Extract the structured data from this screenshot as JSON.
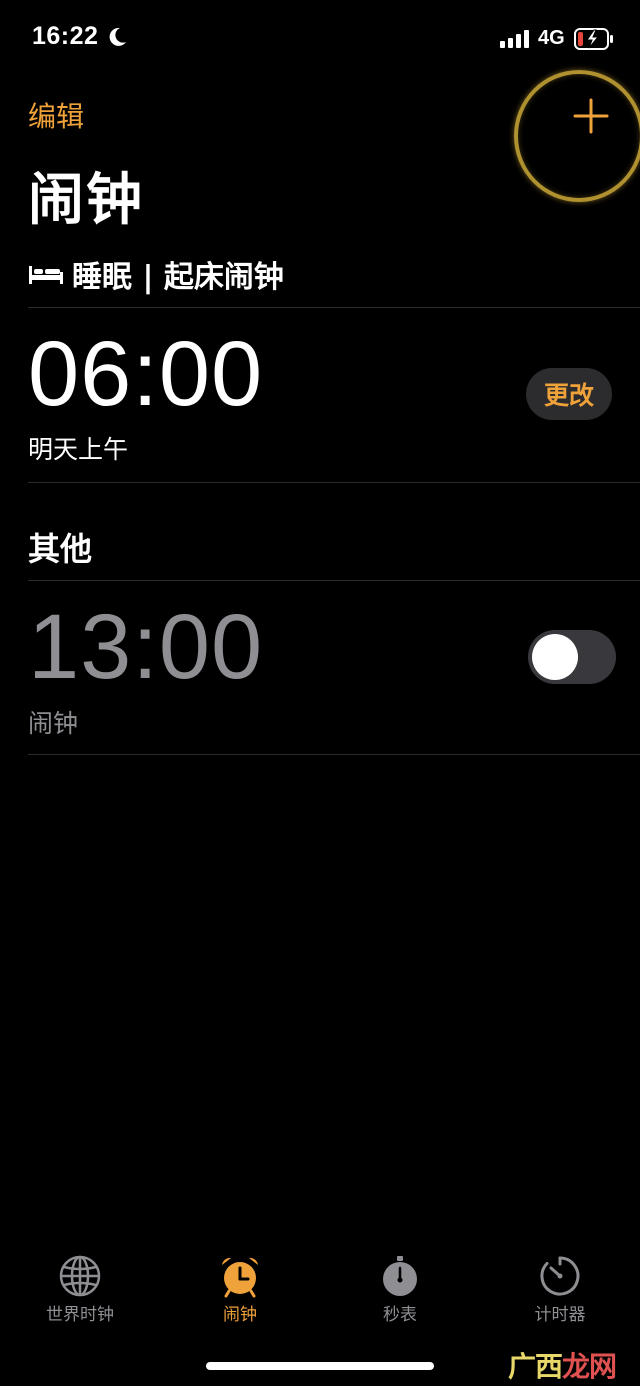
{
  "status_bar": {
    "time": "16:22",
    "network": "4G"
  },
  "nav": {
    "edit_label": "编辑",
    "title": "闹钟"
  },
  "sleep": {
    "section_title": "睡眠 | 起床闹钟",
    "alarm_time": "06:00",
    "alarm_subtitle": "明天上午",
    "change_label": "更改"
  },
  "other": {
    "section_title": "其他",
    "alarms": [
      {
        "time": "13:00",
        "label": "闹钟",
        "enabled": false
      }
    ]
  },
  "tabs": [
    {
      "label": "世界时钟",
      "icon": "globe-icon",
      "active": false
    },
    {
      "label": "闹钟",
      "icon": "alarm-clock-icon",
      "active": true
    },
    {
      "label": "秒表",
      "icon": "stopwatch-icon",
      "active": false
    },
    {
      "label": "计时器",
      "icon": "timer-icon",
      "active": false
    }
  ],
  "watermark": {
    "prefix": "广西",
    "accent": "龙网"
  },
  "colors": {
    "accent": "#f0a23a",
    "background": "#000000",
    "inactive": "#8e8e93",
    "dimmed_time": "#8e8e93"
  }
}
